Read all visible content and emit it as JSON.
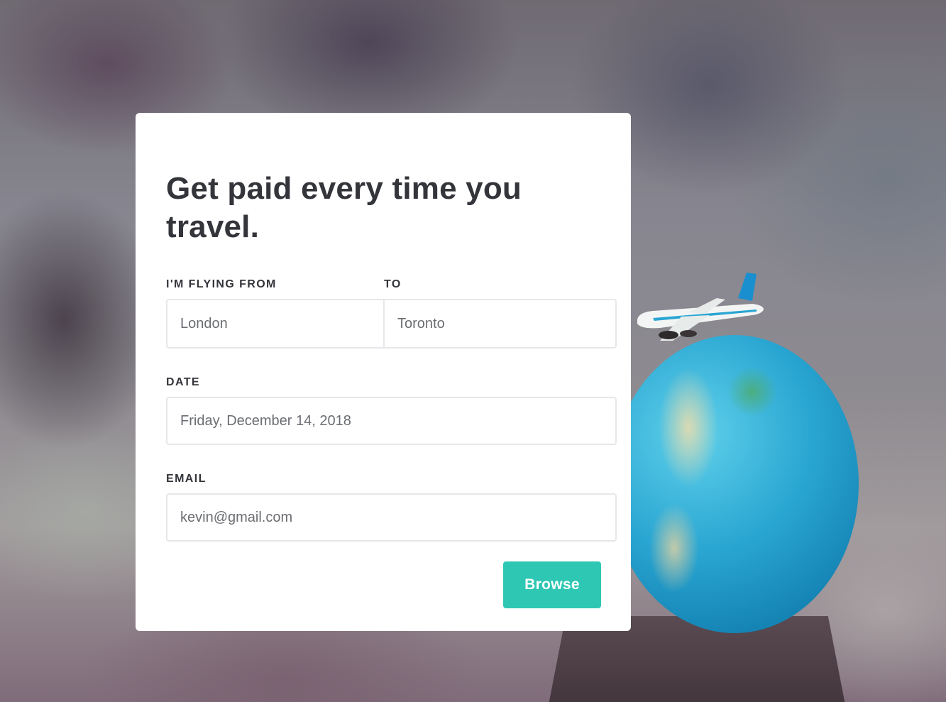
{
  "background": {
    "globe_color": "#2aa6d2",
    "stand_color": "#4b3c44"
  },
  "form": {
    "headline": "Get paid every time you travel.",
    "from_label": "I'M FLYING FROM",
    "to_label": "TO",
    "from_value": "London",
    "to_value": "Toronto",
    "date_label": "DATE",
    "date_value": "Friday, December 14, 2018",
    "email_label": "EMAIL",
    "email_value": "kevin@gmail.com",
    "submit_label": "Browse",
    "accent_color": "#2ec7b4"
  }
}
